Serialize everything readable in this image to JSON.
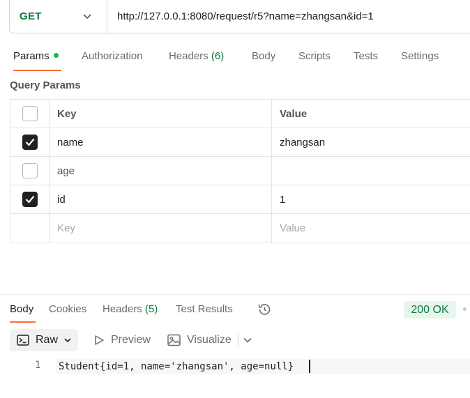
{
  "request": {
    "method": "GET",
    "url": "http://127.0.0.1:8080/request/r5?name=zhangsan&id=1"
  },
  "request_tabs": {
    "params": "Params",
    "authorization": "Authorization",
    "headers_label": "Headers",
    "headers_count": "(6)",
    "body": "Body",
    "scripts": "Scripts",
    "tests": "Tests",
    "settings": "Settings"
  },
  "query_params": {
    "title": "Query Params",
    "columns": {
      "key": "Key",
      "value": "Value"
    },
    "rows": [
      {
        "checked": true,
        "key": "name",
        "value": "zhangsan"
      },
      {
        "checked": false,
        "key": "age",
        "value": ""
      },
      {
        "checked": true,
        "key": "id",
        "value": "1"
      }
    ],
    "new_row": {
      "key_placeholder": "Key",
      "value_placeholder": "Value"
    }
  },
  "response": {
    "tabs": {
      "body": "Body",
      "cookies": "Cookies",
      "headers_label": "Headers",
      "headers_count": "(5)",
      "test_results": "Test Results"
    },
    "status": "200 OK",
    "format": {
      "raw": "Raw",
      "preview": "Preview",
      "visualize": "Visualize"
    },
    "lines": [
      {
        "number": "1",
        "text": "Student{id=1, name='zhangsan', age=null}"
      }
    ]
  },
  "icons": {
    "method_dropdown": "chevron-down-icon",
    "history": "history-icon",
    "raw": "raw-format-icon",
    "preview": "play-icon",
    "visualize": "image-icon"
  },
  "colors": {
    "method_get": "#0b7a3e",
    "active_tab_underline": "#ff6c37",
    "params_dot": "#0cbb52",
    "status_bg": "#e7f6ec",
    "status_text": "#0b7a3e"
  }
}
